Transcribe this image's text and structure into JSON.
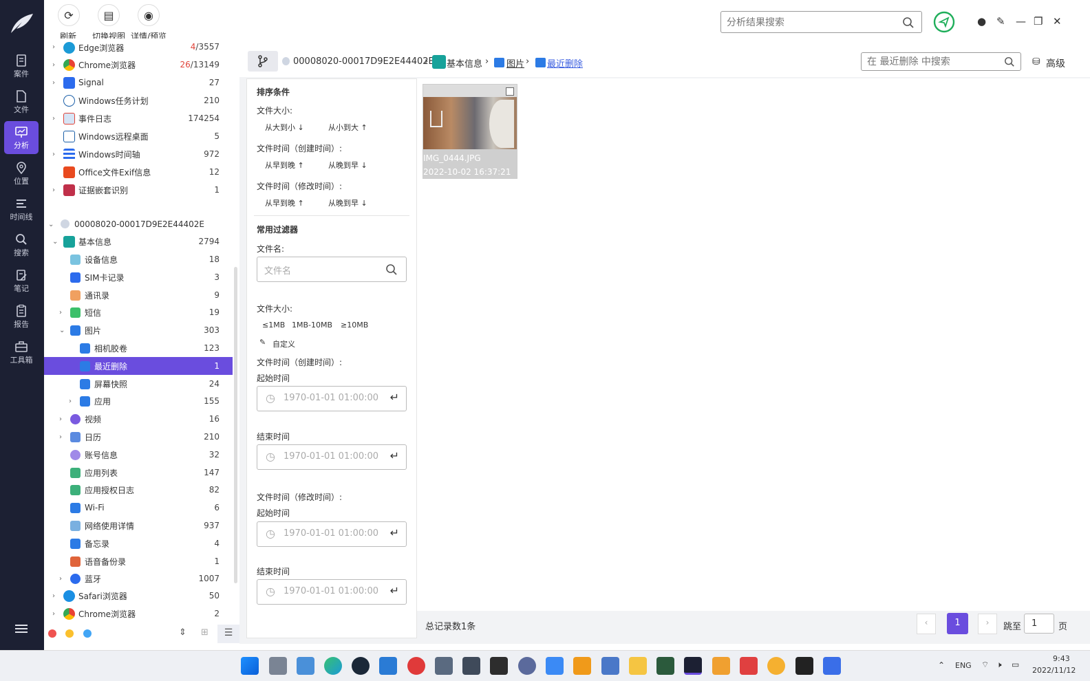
{
  "toolbar": {
    "refresh": "刷新",
    "switch_view": "切换视图",
    "details": "详情/预览",
    "search_placeholder": "分析结果搜索"
  },
  "leftnav": [
    {
      "label": "案件",
      "icon": "case-icon"
    },
    {
      "label": "文件",
      "icon": "file-icon"
    },
    {
      "label": "分析",
      "icon": "analysis-icon"
    },
    {
      "label": "位置",
      "icon": "location-pin-icon"
    },
    {
      "label": "时间线",
      "icon": "timeline-icon"
    },
    {
      "label": "搜索",
      "icon": "search-icon"
    },
    {
      "label": "笔记",
      "icon": "note-icon"
    },
    {
      "label": "报告",
      "icon": "report-icon"
    },
    {
      "label": "工具箱",
      "icon": "toolbox-icon"
    }
  ],
  "tree": {
    "top_rows": [
      {
        "label": "Edge浏览器",
        "count_red": "4",
        "count": "/3557"
      },
      {
        "label": "Chrome浏览器",
        "count_red": "26",
        "count": "/13149"
      },
      {
        "label": "Signal",
        "count_red": "",
        "count": "27"
      },
      {
        "label": "Windows任务计划",
        "count_red": "",
        "count": "210"
      },
      {
        "label": "事件日志",
        "count_red": "",
        "count": "174254"
      },
      {
        "label": "Windows远程桌面",
        "count_red": "",
        "count": "5"
      },
      {
        "label": "Windows时间轴",
        "count_red": "",
        "count": "972"
      },
      {
        "label": "Office文件Exif信息",
        "count_red": "",
        "count": "12"
      },
      {
        "label": "证据嵌套识别",
        "count_red": "",
        "count": "1"
      }
    ],
    "device": "00008020-00017D9E2E44402E",
    "basic_info": {
      "label": "基本信息",
      "count": "2794"
    },
    "children": [
      {
        "label": "设备信息",
        "count": "18"
      },
      {
        "label": "SIM卡记录",
        "count": "3"
      },
      {
        "label": "通讯录",
        "count": "9"
      },
      {
        "label": "短信",
        "count": "19"
      },
      {
        "label": "图片",
        "count": "303"
      },
      {
        "label": "相机胶卷",
        "count": "123"
      },
      {
        "label": "最近删除",
        "count": "1"
      },
      {
        "label": "屏幕快照",
        "count": "24"
      },
      {
        "label": "应用",
        "count": "155"
      },
      {
        "label": "视频",
        "count": "16"
      },
      {
        "label": "日历",
        "count": "210"
      },
      {
        "label": "账号信息",
        "count": "32"
      },
      {
        "label": "应用列表",
        "count": "147"
      },
      {
        "label": "应用授权日志",
        "count": "82"
      },
      {
        "label": "Wi-Fi",
        "count": "6"
      },
      {
        "label": "网络使用详情",
        "count": "937"
      },
      {
        "label": "备忘录",
        "count": "4"
      },
      {
        "label": "语音备份录",
        "count": "1"
      },
      {
        "label": "蓝牙",
        "count": "1007"
      }
    ],
    "bottom_rows": [
      {
        "label": "Safari浏览器",
        "count": "50"
      },
      {
        "label": "Chrome浏览器",
        "count": "2"
      }
    ]
  },
  "breadcrumb": {
    "device": "00008020-00017D9E2E44402E",
    "basic_info": "基本信息",
    "pictures": "图片",
    "current": "最近删除",
    "search_placeholder": "在 最近删除 中搜索",
    "advanced": "高级"
  },
  "filters": {
    "sort_title": "排序条件",
    "size_label": "文件大小:",
    "size_desc": "从大到小",
    "size_asc": "从小到大",
    "ctime_label": "文件时间（创建时间）:",
    "ctime_asc": "从早到晚",
    "ctime_desc": "从晚到早",
    "mtime_label": "文件时间（修改时间）:",
    "mtime_asc": "从早到晚",
    "mtime_desc": "从晚到早",
    "common_title": "常用过滤器",
    "filename_label": "文件名:",
    "filename_placeholder": "文件名",
    "filesize_label": "文件大小:",
    "size_opt1": "≤1MB",
    "size_opt2": "1MB-10MB",
    "size_opt3": "≥10MB",
    "custom": "自定义",
    "ctime_label2": "文件时间（创建时间）:",
    "start_time": "起始时间",
    "end_time": "结束时间",
    "mtime_label2": "文件时间（修改时间）:",
    "start_time2": "起始时间",
    "end_time2": "结束时间",
    "time_placeholder": "1970-01-01 01:00:00"
  },
  "thumbnail": {
    "filename": "IMG_0444.JPG",
    "date": "2022-10-02 16:37:21"
  },
  "footer": {
    "total": "总记录数1条",
    "page": "1",
    "jump_to": "跳至",
    "jump_value": "1",
    "page_unit": "页"
  },
  "taskbar": {
    "lang": "ENG",
    "time": "9:43",
    "date": "2022/11/12"
  },
  "colors": {
    "nav_bg": "#1c2033",
    "accent": "#6a4dde",
    "red": "#e0443a"
  }
}
